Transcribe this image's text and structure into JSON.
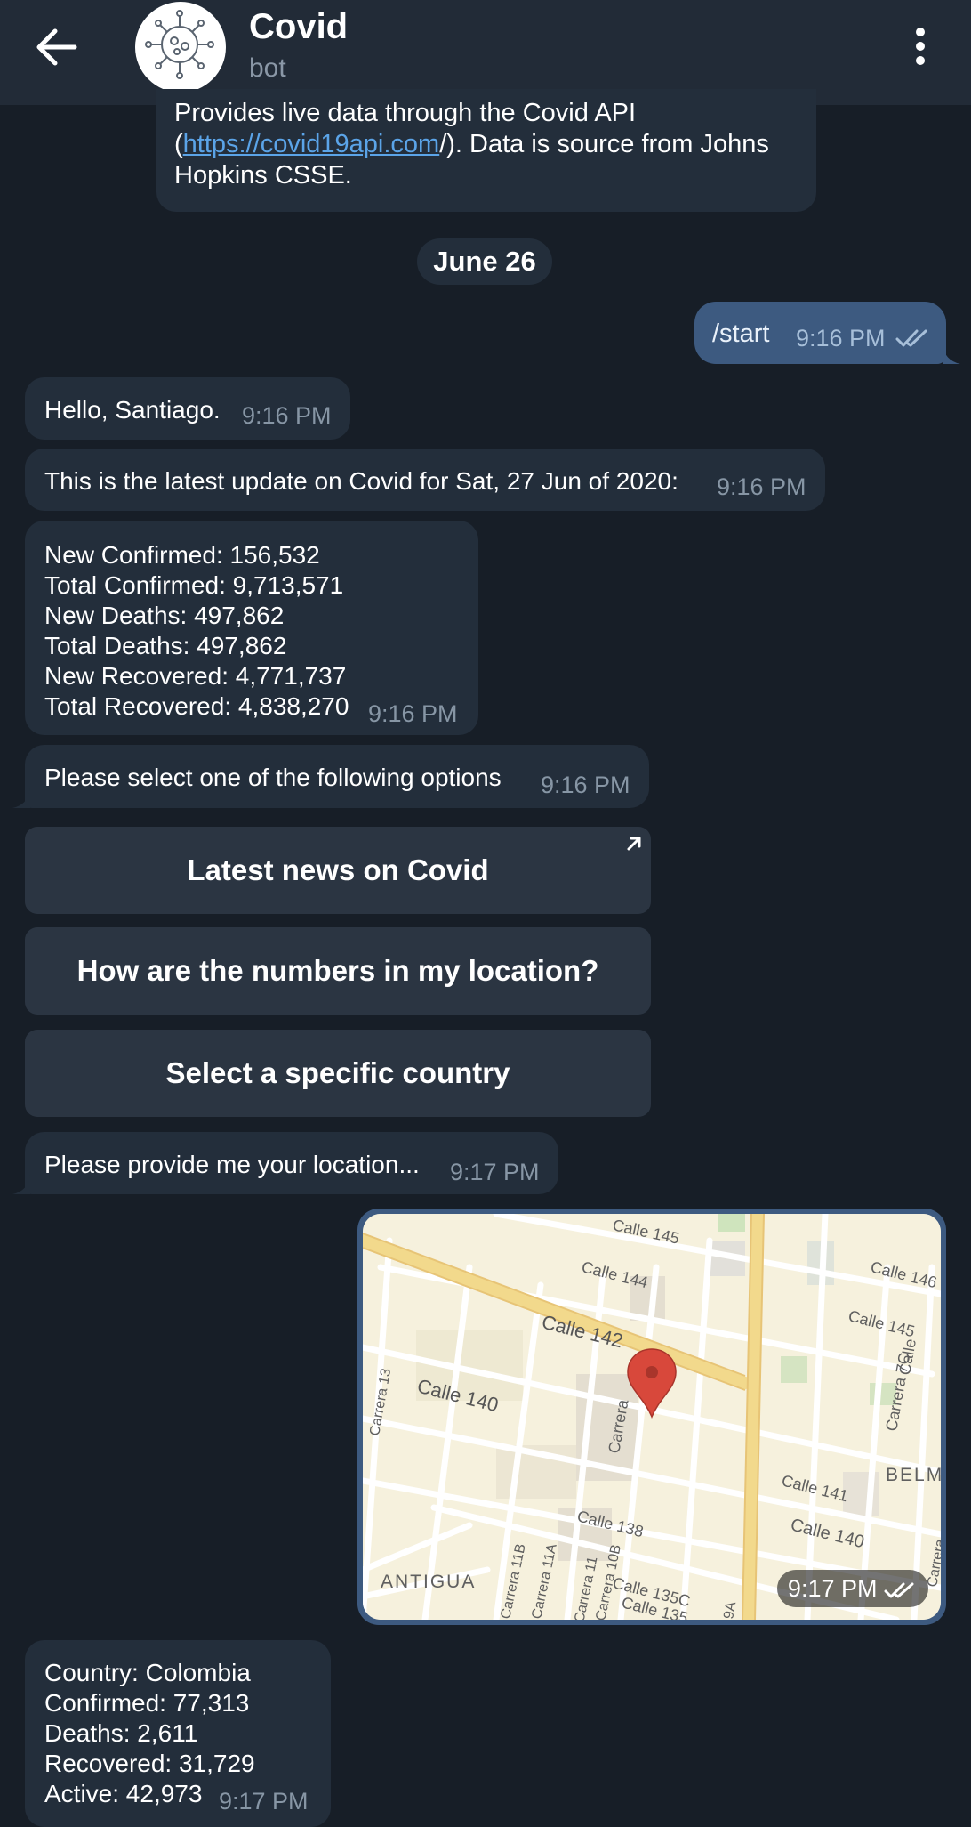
{
  "header": {
    "title": "Covid",
    "subtitle": "bot"
  },
  "intro": {
    "text_before": "Provides live data through the Covid API (",
    "link": "https://covid19api.com",
    "text_after": "/). Data is source from Johns Hopkins CSSE."
  },
  "date_separator": "June 26",
  "outgoing": {
    "text": "/start",
    "time": "9:16 PM"
  },
  "messages": {
    "hello": {
      "text": "Hello, Santiago.",
      "time": "9:16 PM"
    },
    "update": {
      "text": "This is the latest update on Covid for Sat, 27 Jun of 2020:",
      "time": "9:16 PM"
    },
    "stats": {
      "lines": [
        "New Confirmed: 156,532",
        "Total Confirmed: 9,713,571",
        "New Deaths: 497,862",
        "Total Deaths: 497,862",
        "New Recovered: 4,771,737",
        "Total Recovered: 4,838,270"
      ],
      "time": "9:16 PM"
    },
    "options": {
      "text": "Please select one of the following options",
      "time": "9:16 PM"
    },
    "provide_location": {
      "text": "Please provide me your location...",
      "time": "9:17 PM"
    },
    "country": {
      "lines": [
        "Country: Colombia",
        "Confirmed: 77,313",
        "Deaths: 2,611",
        "Recovered: 31,729",
        "Active: 42,973"
      ],
      "time": "9:17 PM"
    }
  },
  "keyboard": {
    "buttons": [
      "Latest news on Covid",
      "How are the numbers in my location?",
      "Select a specific country"
    ]
  },
  "location_map": {
    "time": "9:17 PM",
    "labels": {
      "calle_145_top": "Calle 145",
      "calle_144": "Calle 144",
      "calle_142": "Calle 142",
      "calle_146": "Calle 146",
      "calle_145_right": "Calle 145",
      "calle_140_left": "Calle 140",
      "calle_141": "Calle 141",
      "calle_138": "Calle 138",
      "calle_140_right": "Calle 140",
      "calle_135c": "Calle 135C",
      "calle_135": "Calle 135",
      "carrera_left": "Carrera",
      "carrera_7c": "Carrera 7C",
      "calle_short": "Calle",
      "antigua": "ANTIGUA",
      "belmi": "BELMI",
      "carrera_11b": "Carrera 11B",
      "carrera_11a": "Carrera 11A",
      "carrera_11": "Carrera 11",
      "carrera_10b": "Carrera 10B",
      "cra_13": "Carrera 13",
      "carrera_9a": "9A",
      "carrera_right_edge": "Carrera"
    }
  },
  "colors": {
    "background": "#171e27",
    "header": "#222b37",
    "bubble_in": "#232e3b",
    "bubble_out": "#3d5a80",
    "link": "#5ba4e8",
    "time": "#8796a5",
    "keyboard_button": "#2b3542"
  }
}
